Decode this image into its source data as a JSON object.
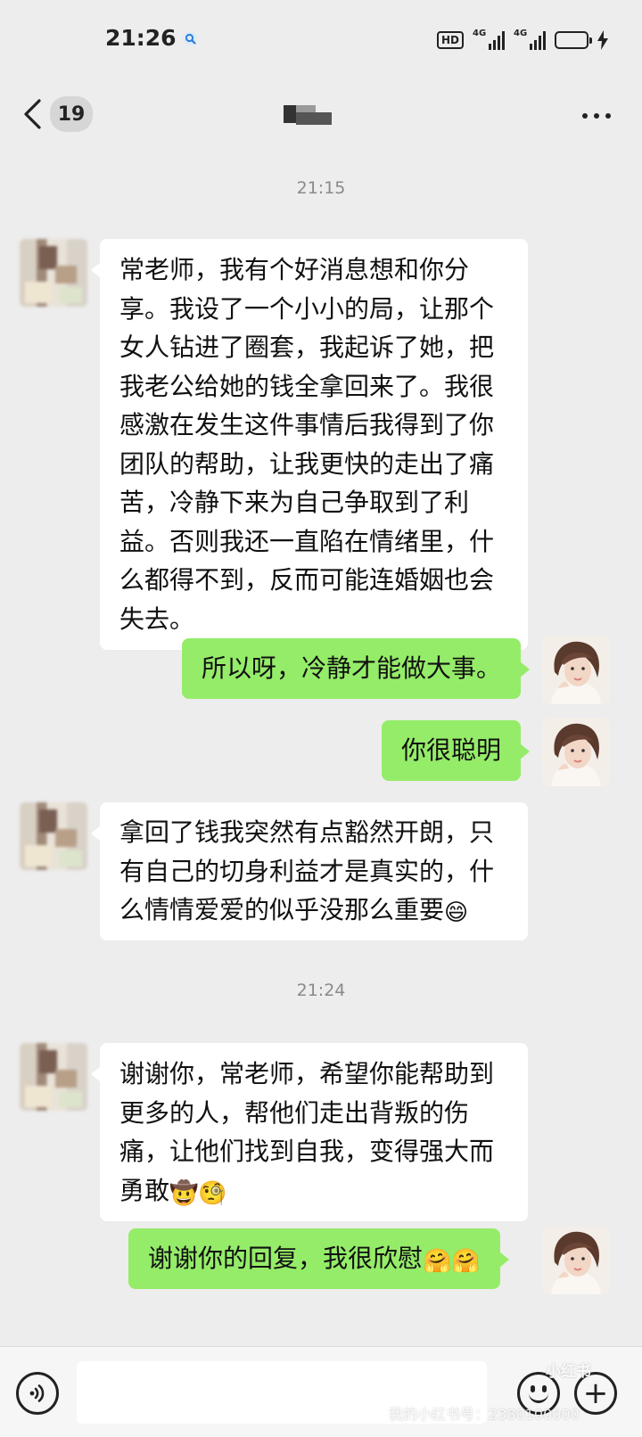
{
  "status_bar": {
    "time": "21:26",
    "hd": "HD",
    "signal1_tag": "4G",
    "signal2_tag": "4G"
  },
  "header": {
    "unread_count": "19"
  },
  "messages": [
    {
      "type": "time",
      "text": "21:15"
    },
    {
      "type": "in",
      "text": "常老师，我有个好消息想和你分享。我设了一个小小的局，让那个女人钻进了圈套，我起诉了她，把我老公给她的钱全拿回来了。我很感激在发生这件事情后我得到了你团队的帮助，让我更快的走出了痛苦，冷静下来为自己争取到了利益。否则我还一直陷在情绪里，什么都得不到，反而可能连婚姻也会失去。"
    },
    {
      "type": "out",
      "text": "所以呀，冷静才能做大事。"
    },
    {
      "type": "out",
      "text": "你很聪明"
    },
    {
      "type": "in",
      "text": "拿回了钱我突然有点豁然开朗，只有自己的切身利益才是真实的，什么情情爱爱的似乎没那么重要",
      "emoji": "😄"
    },
    {
      "type": "time",
      "text": "21:24"
    },
    {
      "type": "in",
      "text": "谢谢你，常老师，希望你能帮助到更多的人，帮他们走出背叛的伤痛，让他们找到自我，变得强大而勇敢",
      "emoji": "🤠🧐"
    },
    {
      "type": "out",
      "text": "谢谢你的回复，我很欣慰",
      "emoji": "🤗🤗"
    }
  ],
  "input": {
    "placeholder": ""
  },
  "watermark": {
    "logo": "小红书",
    "text": "我的小红书号：2380100000"
  }
}
